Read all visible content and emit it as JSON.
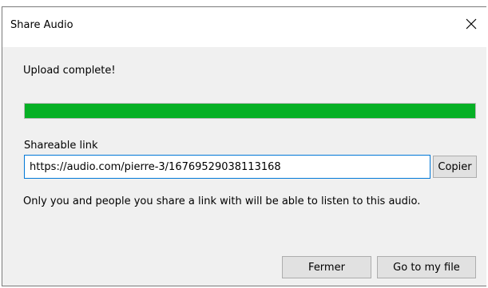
{
  "dialog": {
    "title": "Share Audio",
    "close_icon": "close-icon"
  },
  "upload": {
    "status": "Upload complete!",
    "progress_fraction": 1.0,
    "progress_color": "#06b025"
  },
  "link": {
    "label": "Shareable link",
    "value": "https://audio.com/pierre-3/16769529038113168",
    "copy_label": "Copier"
  },
  "info": "Only you and people you share a link with will be able to listen to this audio.",
  "buttons": {
    "close_label": "Fermer",
    "open_label": "Go to my file"
  }
}
